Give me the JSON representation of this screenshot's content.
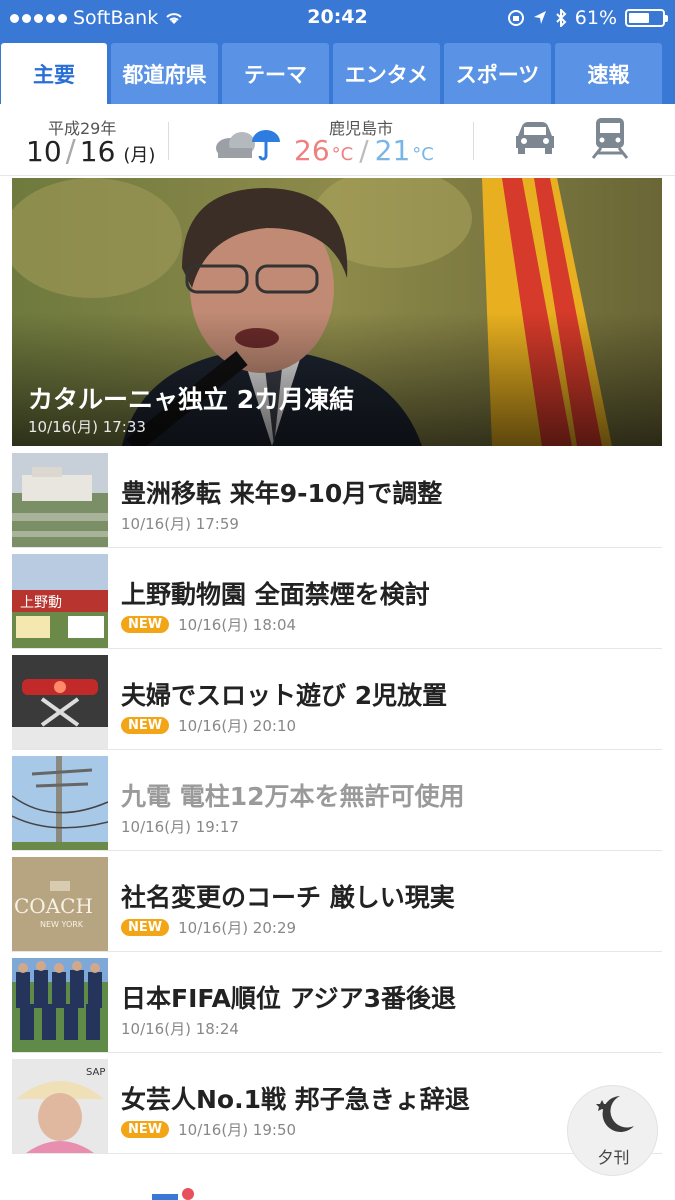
{
  "status": {
    "carrier": "SoftBank",
    "time": "20:42",
    "battery": "61%"
  },
  "tabs": [
    {
      "label": "主要",
      "active": true
    },
    {
      "label": "都道府県"
    },
    {
      "label": "テーマ"
    },
    {
      "label": "エンタメ"
    },
    {
      "label": "スポーツ"
    },
    {
      "label": "速報"
    }
  ],
  "info": {
    "era": "平成29年",
    "month": "10",
    "day": "16",
    "weekday": "(月)",
    "city": "鹿児島市",
    "temp_high": "26",
    "temp_low": "21",
    "unit": "°C"
  },
  "hero": {
    "title": "カタルーニャ独立 2カ月凍結",
    "time": "10/16(月) 17:33"
  },
  "news": [
    {
      "title": "豊洲移転 来年9-10月で調整",
      "time": "10/16(月) 17:59"
    },
    {
      "title": "上野動物園 全面禁煙を検討",
      "time": "10/16(月) 18:04",
      "badge": "NEW"
    },
    {
      "title": "夫婦でスロット遊び 2児放置",
      "time": "10/16(月) 20:10",
      "badge": "NEW"
    },
    {
      "title": "九電 電柱12万本を無許可使用",
      "time": "10/16(月) 19:17"
    },
    {
      "title": "社名変更のコーチ 厳しい現実",
      "time": "10/16(月) 20:29",
      "badge": "NEW"
    },
    {
      "title": "日本FIFA順位 アジア3番後退",
      "time": "10/16(月) 18:24"
    },
    {
      "title": "女芸人No.1戦 邦子急きょ辞退",
      "time": "10/16(月) 19:50",
      "badge": "NEW"
    }
  ],
  "yukan": {
    "label": "夕刊"
  }
}
